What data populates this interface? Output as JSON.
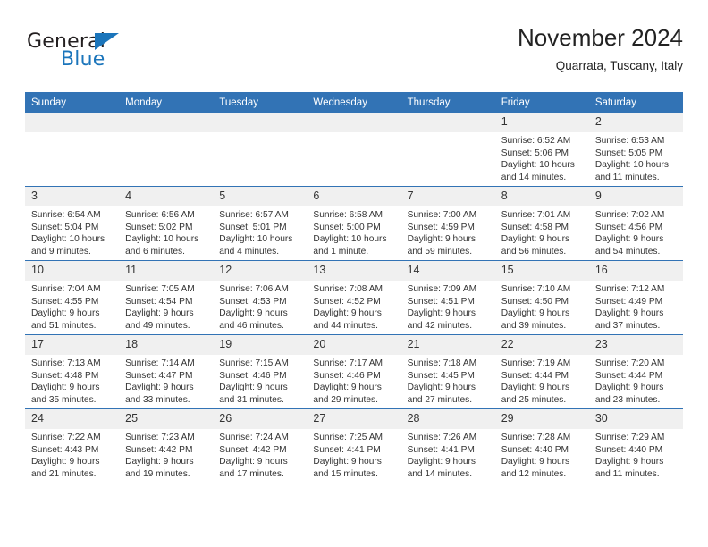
{
  "brand": {
    "word_one": "General",
    "word_two": "Blue",
    "logo_icon": "blue-triangle-icon"
  },
  "header": {
    "title": "November 2024",
    "subtitle": "Quarrata, Tuscany, Italy"
  },
  "theme": {
    "header_blue": "#3273b5",
    "daynum_bg": "#f0f0f0",
    "brand_blue": "#1b75bb",
    "text": "#333333"
  },
  "weekday_headers": [
    "Sunday",
    "Monday",
    "Tuesday",
    "Wednesday",
    "Thursday",
    "Friday",
    "Saturday"
  ],
  "labels": {
    "sunrise": "Sunrise:",
    "sunset": "Sunset:",
    "daylight": "Daylight:"
  },
  "weeks": [
    [
      {
        "day": "",
        "sunrise": "",
        "sunset": "",
        "daylight_a": "",
        "daylight_b": "",
        "empty": true
      },
      {
        "day": "",
        "sunrise": "",
        "sunset": "",
        "daylight_a": "",
        "daylight_b": "",
        "empty": true
      },
      {
        "day": "",
        "sunrise": "",
        "sunset": "",
        "daylight_a": "",
        "daylight_b": "",
        "empty": true
      },
      {
        "day": "",
        "sunrise": "",
        "sunset": "",
        "daylight_a": "",
        "daylight_b": "",
        "empty": true
      },
      {
        "day": "",
        "sunrise": "",
        "sunset": "",
        "daylight_a": "",
        "daylight_b": "",
        "empty": true
      },
      {
        "day": "1",
        "sunrise": "Sunrise: 6:52 AM",
        "sunset": "Sunset: 5:06 PM",
        "daylight_a": "Daylight: 10 hours",
        "daylight_b": "and 14 minutes.",
        "empty": false
      },
      {
        "day": "2",
        "sunrise": "Sunrise: 6:53 AM",
        "sunset": "Sunset: 5:05 PM",
        "daylight_a": "Daylight: 10 hours",
        "daylight_b": "and 11 minutes.",
        "empty": false
      }
    ],
    [
      {
        "day": "3",
        "sunrise": "Sunrise: 6:54 AM",
        "sunset": "Sunset: 5:04 PM",
        "daylight_a": "Daylight: 10 hours",
        "daylight_b": "and 9 minutes.",
        "empty": false
      },
      {
        "day": "4",
        "sunrise": "Sunrise: 6:56 AM",
        "sunset": "Sunset: 5:02 PM",
        "daylight_a": "Daylight: 10 hours",
        "daylight_b": "and 6 minutes.",
        "empty": false
      },
      {
        "day": "5",
        "sunrise": "Sunrise: 6:57 AM",
        "sunset": "Sunset: 5:01 PM",
        "daylight_a": "Daylight: 10 hours",
        "daylight_b": "and 4 minutes.",
        "empty": false
      },
      {
        "day": "6",
        "sunrise": "Sunrise: 6:58 AM",
        "sunset": "Sunset: 5:00 PM",
        "daylight_a": "Daylight: 10 hours",
        "daylight_b": "and 1 minute.",
        "empty": false
      },
      {
        "day": "7",
        "sunrise": "Sunrise: 7:00 AM",
        "sunset": "Sunset: 4:59 PM",
        "daylight_a": "Daylight: 9 hours",
        "daylight_b": "and 59 minutes.",
        "empty": false
      },
      {
        "day": "8",
        "sunrise": "Sunrise: 7:01 AM",
        "sunset": "Sunset: 4:58 PM",
        "daylight_a": "Daylight: 9 hours",
        "daylight_b": "and 56 minutes.",
        "empty": false
      },
      {
        "day": "9",
        "sunrise": "Sunrise: 7:02 AM",
        "sunset": "Sunset: 4:56 PM",
        "daylight_a": "Daylight: 9 hours",
        "daylight_b": "and 54 minutes.",
        "empty": false
      }
    ],
    [
      {
        "day": "10",
        "sunrise": "Sunrise: 7:04 AM",
        "sunset": "Sunset: 4:55 PM",
        "daylight_a": "Daylight: 9 hours",
        "daylight_b": "and 51 minutes.",
        "empty": false
      },
      {
        "day": "11",
        "sunrise": "Sunrise: 7:05 AM",
        "sunset": "Sunset: 4:54 PM",
        "daylight_a": "Daylight: 9 hours",
        "daylight_b": "and 49 minutes.",
        "empty": false
      },
      {
        "day": "12",
        "sunrise": "Sunrise: 7:06 AM",
        "sunset": "Sunset: 4:53 PM",
        "daylight_a": "Daylight: 9 hours",
        "daylight_b": "and 46 minutes.",
        "empty": false
      },
      {
        "day": "13",
        "sunrise": "Sunrise: 7:08 AM",
        "sunset": "Sunset: 4:52 PM",
        "daylight_a": "Daylight: 9 hours",
        "daylight_b": "and 44 minutes.",
        "empty": false
      },
      {
        "day": "14",
        "sunrise": "Sunrise: 7:09 AM",
        "sunset": "Sunset: 4:51 PM",
        "daylight_a": "Daylight: 9 hours",
        "daylight_b": "and 42 minutes.",
        "empty": false
      },
      {
        "day": "15",
        "sunrise": "Sunrise: 7:10 AM",
        "sunset": "Sunset: 4:50 PM",
        "daylight_a": "Daylight: 9 hours",
        "daylight_b": "and 39 minutes.",
        "empty": false
      },
      {
        "day": "16",
        "sunrise": "Sunrise: 7:12 AM",
        "sunset": "Sunset: 4:49 PM",
        "daylight_a": "Daylight: 9 hours",
        "daylight_b": "and 37 minutes.",
        "empty": false
      }
    ],
    [
      {
        "day": "17",
        "sunrise": "Sunrise: 7:13 AM",
        "sunset": "Sunset: 4:48 PM",
        "daylight_a": "Daylight: 9 hours",
        "daylight_b": "and 35 minutes.",
        "empty": false
      },
      {
        "day": "18",
        "sunrise": "Sunrise: 7:14 AM",
        "sunset": "Sunset: 4:47 PM",
        "daylight_a": "Daylight: 9 hours",
        "daylight_b": "and 33 minutes.",
        "empty": false
      },
      {
        "day": "19",
        "sunrise": "Sunrise: 7:15 AM",
        "sunset": "Sunset: 4:46 PM",
        "daylight_a": "Daylight: 9 hours",
        "daylight_b": "and 31 minutes.",
        "empty": false
      },
      {
        "day": "20",
        "sunrise": "Sunrise: 7:17 AM",
        "sunset": "Sunset: 4:46 PM",
        "daylight_a": "Daylight: 9 hours",
        "daylight_b": "and 29 minutes.",
        "empty": false
      },
      {
        "day": "21",
        "sunrise": "Sunrise: 7:18 AM",
        "sunset": "Sunset: 4:45 PM",
        "daylight_a": "Daylight: 9 hours",
        "daylight_b": "and 27 minutes.",
        "empty": false
      },
      {
        "day": "22",
        "sunrise": "Sunrise: 7:19 AM",
        "sunset": "Sunset: 4:44 PM",
        "daylight_a": "Daylight: 9 hours",
        "daylight_b": "and 25 minutes.",
        "empty": false
      },
      {
        "day": "23",
        "sunrise": "Sunrise: 7:20 AM",
        "sunset": "Sunset: 4:44 PM",
        "daylight_a": "Daylight: 9 hours",
        "daylight_b": "and 23 minutes.",
        "empty": false
      }
    ],
    [
      {
        "day": "24",
        "sunrise": "Sunrise: 7:22 AM",
        "sunset": "Sunset: 4:43 PM",
        "daylight_a": "Daylight: 9 hours",
        "daylight_b": "and 21 minutes.",
        "empty": false
      },
      {
        "day": "25",
        "sunrise": "Sunrise: 7:23 AM",
        "sunset": "Sunset: 4:42 PM",
        "daylight_a": "Daylight: 9 hours",
        "daylight_b": "and 19 minutes.",
        "empty": false
      },
      {
        "day": "26",
        "sunrise": "Sunrise: 7:24 AM",
        "sunset": "Sunset: 4:42 PM",
        "daylight_a": "Daylight: 9 hours",
        "daylight_b": "and 17 minutes.",
        "empty": false
      },
      {
        "day": "27",
        "sunrise": "Sunrise: 7:25 AM",
        "sunset": "Sunset: 4:41 PM",
        "daylight_a": "Daylight: 9 hours",
        "daylight_b": "and 15 minutes.",
        "empty": false
      },
      {
        "day": "28",
        "sunrise": "Sunrise: 7:26 AM",
        "sunset": "Sunset: 4:41 PM",
        "daylight_a": "Daylight: 9 hours",
        "daylight_b": "and 14 minutes.",
        "empty": false
      },
      {
        "day": "29",
        "sunrise": "Sunrise: 7:28 AM",
        "sunset": "Sunset: 4:40 PM",
        "daylight_a": "Daylight: 9 hours",
        "daylight_b": "and 12 minutes.",
        "empty": false
      },
      {
        "day": "30",
        "sunrise": "Sunrise: 7:29 AM",
        "sunset": "Sunset: 4:40 PM",
        "daylight_a": "Daylight: 9 hours",
        "daylight_b": "and 11 minutes.",
        "empty": false
      }
    ]
  ]
}
